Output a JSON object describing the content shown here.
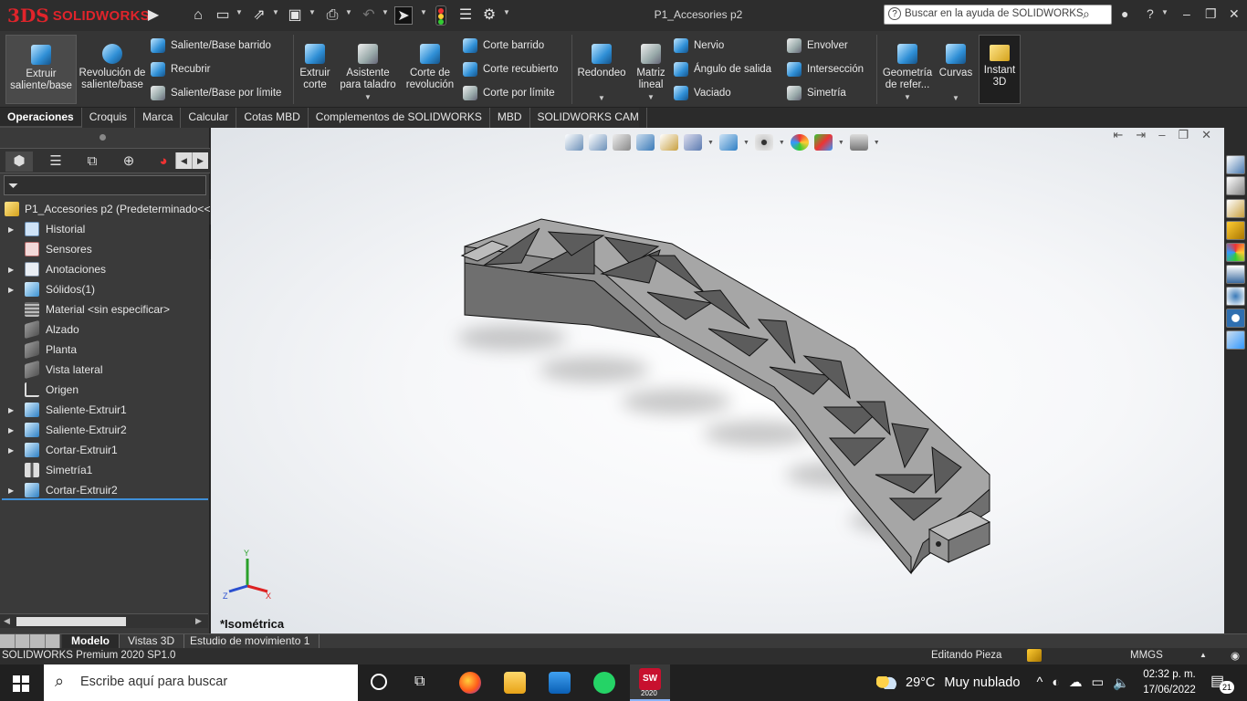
{
  "window": {
    "title": "P1_Accesories p2"
  },
  "logo": {
    "ds": "3DS",
    "name": "SOLIDWORKS"
  },
  "help_search": {
    "placeholder": "Buscar en la ayuda de SOLIDWORKS"
  },
  "command_manager": {
    "extruir_saliente": "Extruir saliente/base",
    "revolucion_saliente": "Revolución de saliente/base",
    "saliente_barrido": "Saliente/Base barrido",
    "recubrir": "Recubrir",
    "saliente_limite": "Saliente/Base por límite",
    "extruir_corte": "Extruir corte",
    "asistente_taladro": "Asistente para taladro",
    "corte_revolucion": "Corte de revolución",
    "corte_barrido": "Corte barrido",
    "corte_recubierto": "Corte recubierto",
    "corte_limite": "Corte por límite",
    "redondeo": "Redondeo",
    "matriz_lineal": "Matriz lineal",
    "nervio": "Nervio",
    "angulo_salida": "Ángulo de salida",
    "vaciado": "Vaciado",
    "envolver": "Envolver",
    "interseccion": "Intersección",
    "simetria": "Simetría",
    "geometria_ref": "Geometría de refer...",
    "curvas": "Curvas",
    "instant3d": "Instant 3D"
  },
  "tabs": [
    "Operaciones",
    "Croquis",
    "Marca",
    "Calcular",
    "Cotas MBD",
    "Complementos de SOLIDWORKS",
    "MBD",
    "SOLIDWORKS CAM"
  ],
  "feature_tree": {
    "root": "P1_Accesories p2  (Predeterminado<<",
    "items": [
      {
        "label": "Historial",
        "expandable": true
      },
      {
        "label": "Sensores",
        "expandable": false
      },
      {
        "label": "Anotaciones",
        "expandable": true
      },
      {
        "label": "Sólidos(1)",
        "expandable": true
      },
      {
        "label": "Material <sin especificar>",
        "expandable": false
      },
      {
        "label": "Alzado",
        "expandable": false
      },
      {
        "label": "Planta",
        "expandable": false
      },
      {
        "label": "Vista lateral",
        "expandable": false
      },
      {
        "label": "Origen",
        "expandable": false
      },
      {
        "label": "Saliente-Extruir1",
        "expandable": true
      },
      {
        "label": "Saliente-Extruir2",
        "expandable": true
      },
      {
        "label": "Cortar-Extruir1",
        "expandable": true
      },
      {
        "label": "Simetría1",
        "expandable": false
      },
      {
        "label": "Cortar-Extruir2",
        "expandable": true
      }
    ]
  },
  "viewport": {
    "view_name": "*Isométrica",
    "triad": {
      "x": "X",
      "y": "Y",
      "z": "Z"
    }
  },
  "bottom_tabs": [
    "Modelo",
    "Vistas 3D",
    "Estudio de movimiento 1"
  ],
  "status": {
    "product": "SOLIDWORKS Premium 2020 SP1.0",
    "mode": "Editando Pieza",
    "units": "MMGS"
  },
  "taskbar": {
    "search_placeholder": "Escribe aquí para buscar",
    "weather_temp": "29°C",
    "weather_text": "Muy nublado",
    "time": "02:32 p. m.",
    "date": "17/06/2022",
    "notifications": "21",
    "sw_year": "2020"
  },
  "colors": {
    "accent_red": "#e0242b",
    "selection_blue": "#3f8fd8",
    "part_grey": "#8c8c8c"
  }
}
